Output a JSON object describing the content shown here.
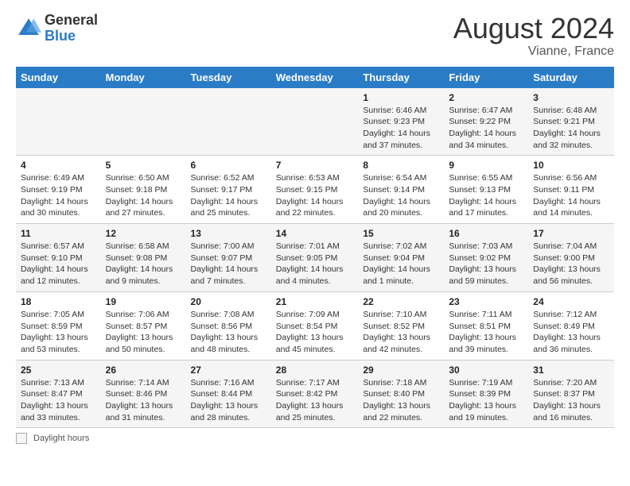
{
  "header": {
    "logo_general": "General",
    "logo_blue": "Blue",
    "month_year": "August 2024",
    "location": "Vianne, France"
  },
  "calendar": {
    "days_of_week": [
      "Sunday",
      "Monday",
      "Tuesday",
      "Wednesday",
      "Thursday",
      "Friday",
      "Saturday"
    ],
    "weeks": [
      [
        {
          "day": "",
          "info": ""
        },
        {
          "day": "",
          "info": ""
        },
        {
          "day": "",
          "info": ""
        },
        {
          "day": "",
          "info": ""
        },
        {
          "day": "1",
          "info": "Sunrise: 6:46 AM\nSunset: 9:23 PM\nDaylight: 14 hours and 37 minutes."
        },
        {
          "day": "2",
          "info": "Sunrise: 6:47 AM\nSunset: 9:22 PM\nDaylight: 14 hours and 34 minutes."
        },
        {
          "day": "3",
          "info": "Sunrise: 6:48 AM\nSunset: 9:21 PM\nDaylight: 14 hours and 32 minutes."
        }
      ],
      [
        {
          "day": "4",
          "info": "Sunrise: 6:49 AM\nSunset: 9:19 PM\nDaylight: 14 hours and 30 minutes."
        },
        {
          "day": "5",
          "info": "Sunrise: 6:50 AM\nSunset: 9:18 PM\nDaylight: 14 hours and 27 minutes."
        },
        {
          "day": "6",
          "info": "Sunrise: 6:52 AM\nSunset: 9:17 PM\nDaylight: 14 hours and 25 minutes."
        },
        {
          "day": "7",
          "info": "Sunrise: 6:53 AM\nSunset: 9:15 PM\nDaylight: 14 hours and 22 minutes."
        },
        {
          "day": "8",
          "info": "Sunrise: 6:54 AM\nSunset: 9:14 PM\nDaylight: 14 hours and 20 minutes."
        },
        {
          "day": "9",
          "info": "Sunrise: 6:55 AM\nSunset: 9:13 PM\nDaylight: 14 hours and 17 minutes."
        },
        {
          "day": "10",
          "info": "Sunrise: 6:56 AM\nSunset: 9:11 PM\nDaylight: 14 hours and 14 minutes."
        }
      ],
      [
        {
          "day": "11",
          "info": "Sunrise: 6:57 AM\nSunset: 9:10 PM\nDaylight: 14 hours and 12 minutes."
        },
        {
          "day": "12",
          "info": "Sunrise: 6:58 AM\nSunset: 9:08 PM\nDaylight: 14 hours and 9 minutes."
        },
        {
          "day": "13",
          "info": "Sunrise: 7:00 AM\nSunset: 9:07 PM\nDaylight: 14 hours and 7 minutes."
        },
        {
          "day": "14",
          "info": "Sunrise: 7:01 AM\nSunset: 9:05 PM\nDaylight: 14 hours and 4 minutes."
        },
        {
          "day": "15",
          "info": "Sunrise: 7:02 AM\nSunset: 9:04 PM\nDaylight: 14 hours and 1 minute."
        },
        {
          "day": "16",
          "info": "Sunrise: 7:03 AM\nSunset: 9:02 PM\nDaylight: 13 hours and 59 minutes."
        },
        {
          "day": "17",
          "info": "Sunrise: 7:04 AM\nSunset: 9:00 PM\nDaylight: 13 hours and 56 minutes."
        }
      ],
      [
        {
          "day": "18",
          "info": "Sunrise: 7:05 AM\nSunset: 8:59 PM\nDaylight: 13 hours and 53 minutes."
        },
        {
          "day": "19",
          "info": "Sunrise: 7:06 AM\nSunset: 8:57 PM\nDaylight: 13 hours and 50 minutes."
        },
        {
          "day": "20",
          "info": "Sunrise: 7:08 AM\nSunset: 8:56 PM\nDaylight: 13 hours and 48 minutes."
        },
        {
          "day": "21",
          "info": "Sunrise: 7:09 AM\nSunset: 8:54 PM\nDaylight: 13 hours and 45 minutes."
        },
        {
          "day": "22",
          "info": "Sunrise: 7:10 AM\nSunset: 8:52 PM\nDaylight: 13 hours and 42 minutes."
        },
        {
          "day": "23",
          "info": "Sunrise: 7:11 AM\nSunset: 8:51 PM\nDaylight: 13 hours and 39 minutes."
        },
        {
          "day": "24",
          "info": "Sunrise: 7:12 AM\nSunset: 8:49 PM\nDaylight: 13 hours and 36 minutes."
        }
      ],
      [
        {
          "day": "25",
          "info": "Sunrise: 7:13 AM\nSunset: 8:47 PM\nDaylight: 13 hours and 33 minutes."
        },
        {
          "day": "26",
          "info": "Sunrise: 7:14 AM\nSunset: 8:46 PM\nDaylight: 13 hours and 31 minutes."
        },
        {
          "day": "27",
          "info": "Sunrise: 7:16 AM\nSunset: 8:44 PM\nDaylight: 13 hours and 28 minutes."
        },
        {
          "day": "28",
          "info": "Sunrise: 7:17 AM\nSunset: 8:42 PM\nDaylight: 13 hours and 25 minutes."
        },
        {
          "day": "29",
          "info": "Sunrise: 7:18 AM\nSunset: 8:40 PM\nDaylight: 13 hours and 22 minutes."
        },
        {
          "day": "30",
          "info": "Sunrise: 7:19 AM\nSunset: 8:39 PM\nDaylight: 13 hours and 19 minutes."
        },
        {
          "day": "31",
          "info": "Sunrise: 7:20 AM\nSunset: 8:37 PM\nDaylight: 13 hours and 16 minutes."
        }
      ]
    ]
  },
  "footer": {
    "daylight_label": "Daylight hours"
  }
}
